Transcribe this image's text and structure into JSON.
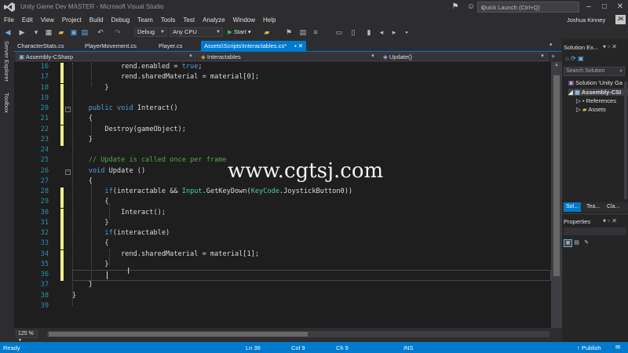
{
  "window": {
    "title": "Unity Game Dev MASTER - Microsoft Visual Studio",
    "quick_launch_placeholder": "Quick Launch (Ctrl+Q)",
    "user_name": "Joshua Kinney",
    "avatar_initials": "JK"
  },
  "menu": [
    "File",
    "Edit",
    "View",
    "Project",
    "Build",
    "Debug",
    "Team",
    "Tools",
    "Test",
    "Analyze",
    "Window",
    "Help"
  ],
  "toolbar": {
    "configuration": "Debug",
    "platform": "Any CPU",
    "start_label": "Start"
  },
  "left_strip": {
    "server_explorer": "Server Explorer",
    "toolbox": "Toolbox"
  },
  "tabs": [
    {
      "label": "CharacterStats.cs",
      "active": false
    },
    {
      "label": "PlayerMovement.cs",
      "active": false
    },
    {
      "label": "Player.cs",
      "active": false
    },
    {
      "label": "Assets\\Scripts\\Interactables.cs*",
      "active": true
    }
  ],
  "navbar": {
    "project": "Assembly-CSharp",
    "type": "Interactables",
    "member": "Update()"
  },
  "code": {
    "lines": [
      {
        "n": "16",
        "indent": "            ",
        "parts": [
          [
            "rend.enabled = ",
            ""
          ],
          [
            "true",
            "kw"
          ],
          [
            ";",
            ""
          ]
        ],
        "changed": true
      },
      {
        "n": "17",
        "indent": "            ",
        "parts": [
          [
            "rend.sharedMaterial = material[0];",
            ""
          ]
        ],
        "changed": true
      },
      {
        "n": "18",
        "indent": "        ",
        "parts": [
          [
            "}",
            ""
          ]
        ],
        "changed": true
      },
      {
        "n": "19",
        "indent": "",
        "parts": [],
        "changed": true
      },
      {
        "n": "20",
        "indent": "    ",
        "parts": [
          [
            "public",
            "kw"
          ],
          [
            " ",
            ""
          ],
          [
            "void",
            "kw"
          ],
          [
            " Interact()",
            ""
          ]
        ],
        "changed": true
      },
      {
        "n": "21",
        "indent": "    ",
        "parts": [
          [
            "{",
            ""
          ]
        ],
        "changed": true
      },
      {
        "n": "22",
        "indent": "        ",
        "parts": [
          [
            "Destroy(gameObject);",
            ""
          ]
        ],
        "changed": true
      },
      {
        "n": "23",
        "indent": "    ",
        "parts": [
          [
            "}",
            ""
          ]
        ],
        "changed": true
      },
      {
        "n": "24",
        "indent": "",
        "parts": [],
        "changed": false
      },
      {
        "n": "25",
        "indent": "    ",
        "parts": [
          [
            "// Update is called once per frame",
            "cm"
          ]
        ],
        "changed": false
      },
      {
        "n": "26",
        "indent": "    ",
        "parts": [
          [
            "void",
            "kw"
          ],
          [
            " Update ()",
            ""
          ]
        ],
        "changed": false
      },
      {
        "n": "27",
        "indent": "    ",
        "parts": [
          [
            "{",
            ""
          ]
        ],
        "changed": false
      },
      {
        "n": "28",
        "indent": "        ",
        "parts": [
          [
            "if",
            "kw"
          ],
          [
            "(interactable && ",
            ""
          ],
          [
            "Input",
            "ty"
          ],
          [
            ".GetKeyDown(",
            ""
          ],
          [
            "KeyCode",
            "ty"
          ],
          [
            ".JoystickButton0))",
            ""
          ]
        ],
        "changed": true
      },
      {
        "n": "29",
        "indent": "        ",
        "parts": [
          [
            "{",
            ""
          ]
        ],
        "changed": true
      },
      {
        "n": "30",
        "indent": "            ",
        "parts": [
          [
            "Interact();",
            ""
          ]
        ],
        "changed": true
      },
      {
        "n": "31",
        "indent": "        ",
        "parts": [
          [
            "}",
            ""
          ]
        ],
        "changed": true
      },
      {
        "n": "32",
        "indent": "        ",
        "parts": [
          [
            "if",
            "kw"
          ],
          [
            "(interactable)",
            ""
          ]
        ],
        "changed": true
      },
      {
        "n": "33",
        "indent": "        ",
        "parts": [
          [
            "{",
            ""
          ]
        ],
        "changed": true
      },
      {
        "n": "34",
        "indent": "            ",
        "parts": [
          [
            "rend.sharedMaterial = material[1];",
            ""
          ]
        ],
        "changed": true
      },
      {
        "n": "35",
        "indent": "        ",
        "parts": [
          [
            "}",
            ""
          ]
        ],
        "changed": true
      },
      {
        "n": "36",
        "indent": "",
        "parts": [],
        "changed": true
      },
      {
        "n": "37",
        "indent": "    ",
        "parts": [
          [
            "}",
            ""
          ]
        ],
        "changed": false
      },
      {
        "n": "38",
        "indent": "",
        "parts": [
          [
            "}",
            ""
          ]
        ],
        "changed": false
      },
      {
        "n": "39",
        "indent": "",
        "parts": [],
        "changed": false
      }
    ]
  },
  "watermark": "www.cgtsj.com",
  "zoom_level": "125 %",
  "solution_explorer": {
    "title": "Solution Ex...",
    "search_placeholder": "Search Solution",
    "items": [
      {
        "label": "Solution 'Unity Ga",
        "icon": "solution-icon"
      },
      {
        "label": "Assembly-CSI",
        "icon": "csharp-project-icon"
      },
      {
        "label": "References",
        "icon": "references-icon"
      },
      {
        "label": "Assets",
        "icon": "folder-icon"
      }
    ],
    "bottom_tabs": [
      "Sol...",
      "Tea...",
      "Cla..."
    ]
  },
  "properties": {
    "title": "Properties"
  },
  "status_bar": {
    "state": "Ready",
    "line": "Ln 36",
    "col": "Col 9",
    "ch": "Ch 9",
    "mode": "INS",
    "publish": "Publish"
  },
  "colors": {
    "accent": "#007acc",
    "editor_bg": "#1e1e1e",
    "keyword": "#569cd6",
    "comment": "#57a64a",
    "type": "#4ec9b0",
    "change_marker": "#efef8a"
  }
}
